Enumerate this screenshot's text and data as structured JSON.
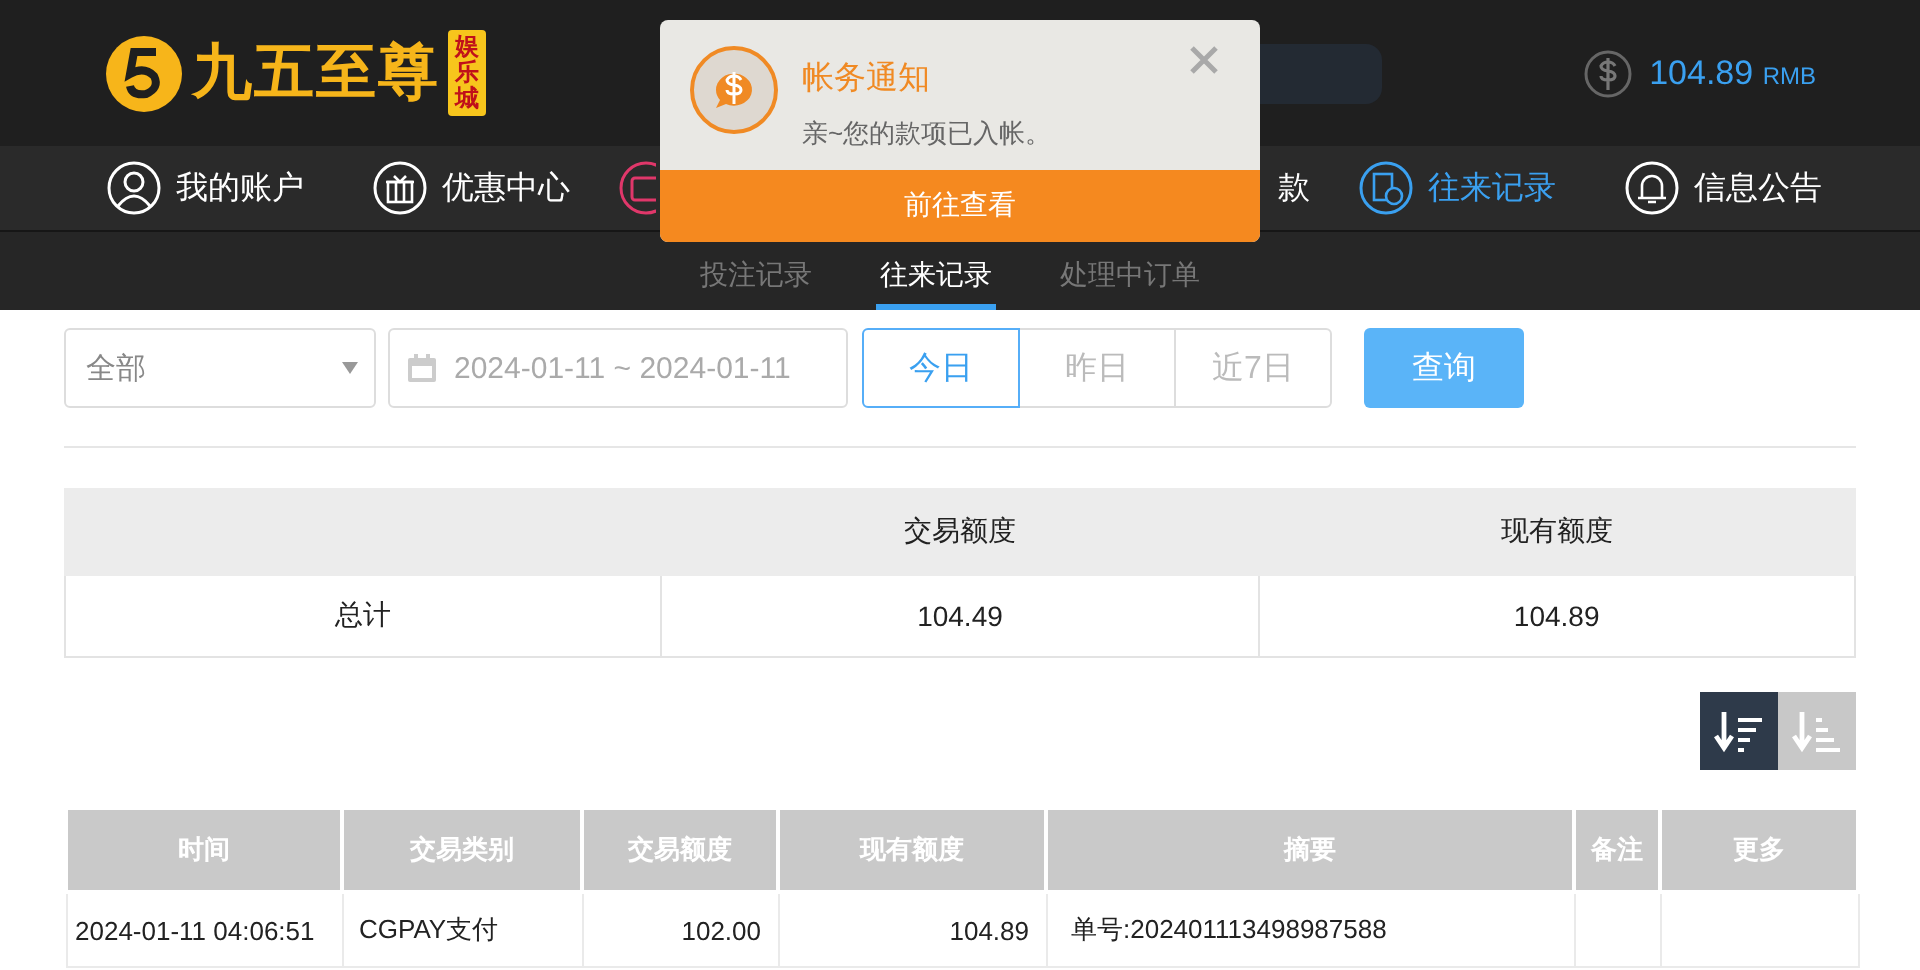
{
  "logo": {
    "name": "九五至尊",
    "badge": "娱乐城"
  },
  "balance": {
    "amount": "104.89",
    "currency": "RMB"
  },
  "nav": [
    {
      "label": "我的账户",
      "selected": false
    },
    {
      "label": "优惠中心",
      "selected": false
    },
    {
      "label": "款",
      "selected": false
    },
    {
      "label": "往来记录",
      "selected": true
    },
    {
      "label": "信息公告",
      "selected": false
    }
  ],
  "sub_tabs": [
    {
      "label": "投注记录",
      "selected": false
    },
    {
      "label": "往来记录",
      "selected": true
    },
    {
      "label": "处理中订单",
      "selected": false
    }
  ],
  "notice": {
    "title": "帐务通知",
    "message": "亲~您的款项已入帐。",
    "button": "前往查看"
  },
  "filter": {
    "type_select": "全部",
    "date_range": "2024-01-11 ~ 2024-01-11",
    "quick_ranges": [
      {
        "label": "今日",
        "selected": true
      },
      {
        "label": "昨日",
        "selected": false
      },
      {
        "label": "近7日",
        "selected": false
      }
    ],
    "search_button": "查询"
  },
  "summary": {
    "columns": [
      "交易额度",
      "现有额度"
    ],
    "rows": [
      {
        "label": "总计",
        "values": [
          "104.49",
          "104.89"
        ]
      }
    ]
  },
  "sort_buttons": [
    {
      "kind": "desc",
      "selected": true
    },
    {
      "kind": "asc",
      "selected": false
    }
  ],
  "records": {
    "columns": [
      "时间",
      "交易类别",
      "交易额度",
      "现有额度",
      "摘要",
      "备注",
      "更多"
    ],
    "rows": [
      {
        "time": "2024-01-11 04:06:51",
        "type": "CGPAY支付",
        "amount": "102.00",
        "balance": "104.89",
        "summary": "单号:202401113498987588"
      }
    ]
  }
}
